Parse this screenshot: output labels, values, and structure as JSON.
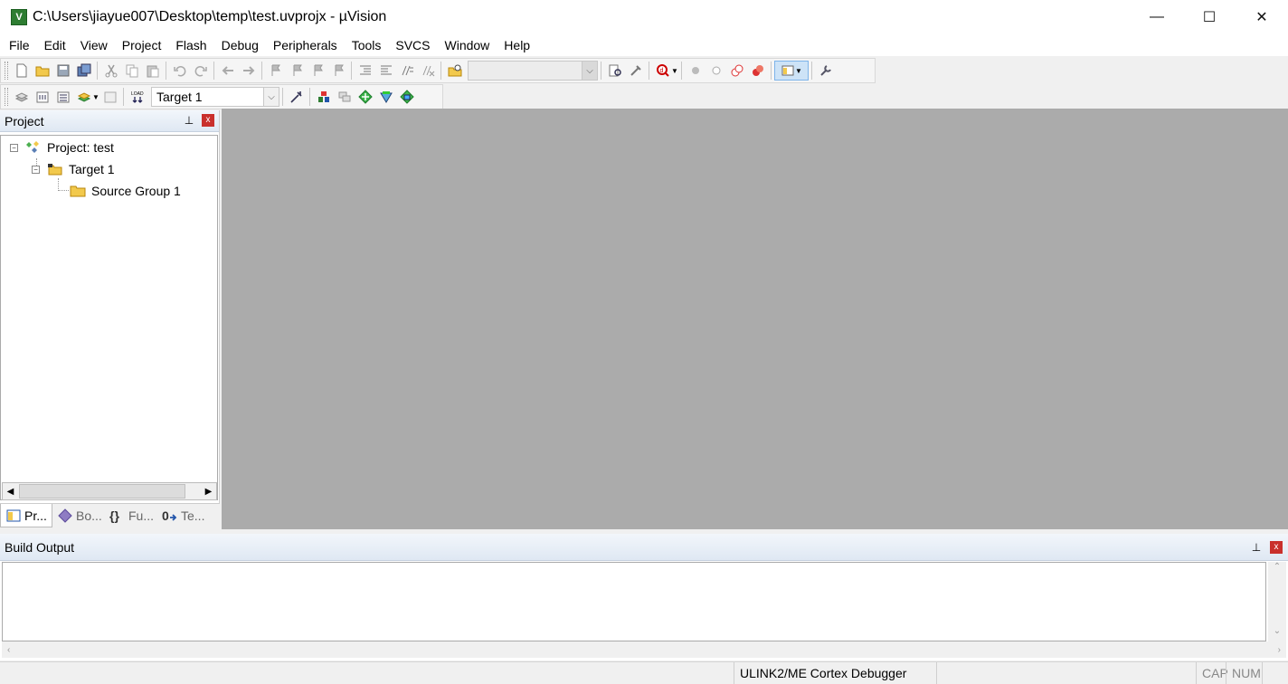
{
  "window": {
    "title": "C:\\Users\\jiayue007\\Desktop\\temp\\test.uvprojx - µVision",
    "logo_text": "V",
    "minimize": "—",
    "maximize": "☐",
    "close": "✕"
  },
  "menu": [
    "File",
    "Edit",
    "View",
    "Project",
    "Flash",
    "Debug",
    "Peripherals",
    "Tools",
    "SVCS",
    "Window",
    "Help"
  ],
  "toolbar2": {
    "target_value": "Target 1"
  },
  "project_pane": {
    "title": "Project",
    "pin": "📌",
    "close": "x",
    "tree": {
      "project": "Project: test",
      "target": "Target 1",
      "group": "Source Group 1"
    },
    "tabs": [
      "Pr...",
      "Bo...",
      "Fu...",
      "Te..."
    ]
  },
  "build_output": {
    "title": "Build Output",
    "pin": "📌",
    "close": "x"
  },
  "status": {
    "debugger": "ULINK2/ME Cortex Debugger",
    "caps": "CAP",
    "num": "NUM"
  },
  "colors": {
    "editor_bg": "#ababab",
    "pane_header": "#dfe8f3",
    "close_red": "#c9302c"
  }
}
